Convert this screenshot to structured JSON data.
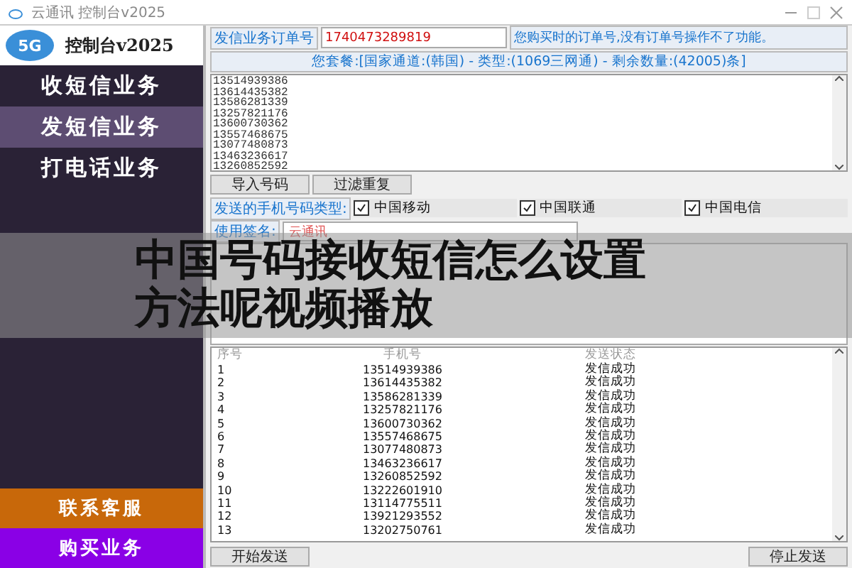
{
  "window": {
    "title": "云通讯 控制台v2025"
  },
  "sidebar": {
    "logo_badge": "5G",
    "logo_text": "控制台v2025",
    "items": [
      {
        "label": "收短信业务",
        "selected": false
      },
      {
        "label": "发短信业务",
        "selected": true
      },
      {
        "label": "打电话业务",
        "selected": false
      }
    ],
    "bottom_items": [
      {
        "label": "联系客服",
        "color": "#c8680a"
      },
      {
        "label": "购买业务",
        "color": "#8a00e6"
      }
    ]
  },
  "order": {
    "label": "发信业务订单号",
    "value": "1740473289819",
    "hint": "您购买时的订单号,没有订单号操作不了功能。"
  },
  "package_info": "您套餐:[国家通道:(韩国) - 类型:(1069三网通) - 剩余数量:(42005)条]",
  "numbers_box": {
    "lines": [
      "13514939386",
      "13614435382",
      "13586281339",
      "13257821176",
      "13600730362",
      "13557468675",
      "13077480873",
      "13463236617",
      "13260852592"
    ]
  },
  "number_buttons": [
    "导入号码",
    "过滤重复"
  ],
  "carrier_types": {
    "label": "发送的手机号码类型:",
    "options": [
      {
        "label": "中国移动",
        "checked": true
      },
      {
        "label": "中国联通",
        "checked": true
      },
      {
        "label": "中国电信",
        "checked": true
      }
    ]
  },
  "signature": {
    "label": "使用签名:",
    "value": "云通讯"
  },
  "table": {
    "columns": [
      "序号",
      "手机号",
      "发送状态"
    ],
    "rows": [
      {
        "index": "1",
        "phone": "13514939386",
        "status": "发信成功"
      },
      {
        "index": "2",
        "phone": "13614435382",
        "status": "发信成功"
      },
      {
        "index": "3",
        "phone": "13586281339",
        "status": "发信成功"
      },
      {
        "index": "4",
        "phone": "13257821176",
        "status": "发信成功"
      },
      {
        "index": "5",
        "phone": "13600730362",
        "status": "发信成功"
      },
      {
        "index": "6",
        "phone": "13557468675",
        "status": "发信成功"
      },
      {
        "index": "7",
        "phone": "13077480873",
        "status": "发信成功"
      },
      {
        "index": "8",
        "phone": "13463236617",
        "status": "发信成功"
      },
      {
        "index": "9",
        "phone": "13260852592",
        "status": "发信成功"
      },
      {
        "index": "10",
        "phone": "13222601910",
        "status": "发信成功"
      },
      {
        "index": "11",
        "phone": "13114775511",
        "status": "发信成功"
      },
      {
        "index": "12",
        "phone": "13921293552",
        "status": "发信成功"
      },
      {
        "index": "13",
        "phone": "13202750761",
        "status": "发信成功"
      }
    ]
  },
  "footer_buttons": [
    "开始发送",
    "停止发送"
  ],
  "overlay_caption": [
    "中国号码接收短信怎么设置",
    "方法呢视频播放"
  ]
}
